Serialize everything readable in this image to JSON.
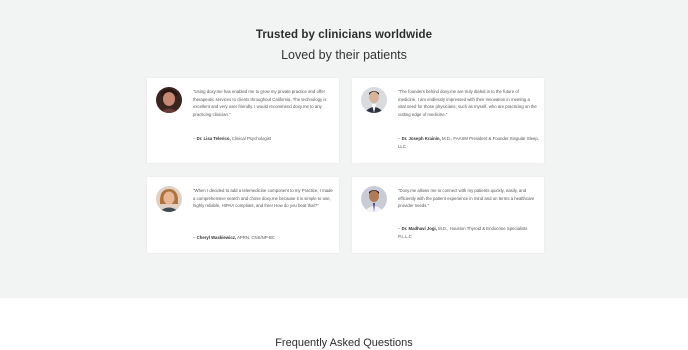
{
  "heading": "Trusted by clinicians worldwide",
  "subheading": "Loved by their patients",
  "testimonials": [
    {
      "quote": "\"Using doxy.me has enabled me to grow my private practice and offer therapeutic services to clients throughout California. The technology is excellent and very user friendly. I would recommend doxy.me to any practicing clinician.\"",
      "name": "Dr. Lisa Telerico,",
      "title": "Clinical Psychologist",
      "avatar_icon": "avatar-woman-dark-hair-icon"
    },
    {
      "quote": "\"The founders behind doxy.me are truly dialed in to the future of medicine. I am endlessly impressed with their innovation in meeting a vital need for those physicians, such as myself, who are practicing on the cutting edge of medicine.\"",
      "name": "Dr. Joseph Krainin,",
      "title": "M.D., FAASM President & Founder Singular Sleep, LLC",
      "avatar_icon": "avatar-man-suit-icon"
    },
    {
      "quote": "\"When I decided to add a telemedicine component to my Practice, I made a comprehensive search and chose doxy.me because it is simple to use, highly reliable, HIPAA compliant, and free! How do you beat that?\"",
      "name": "Cheryl Waskiewicz,",
      "title": "APRN, CNS/NP-BC",
      "avatar_icon": "avatar-woman-light-hair-icon"
    },
    {
      "quote": "\"Doxy.me allows me to connect with my patients quickly, easily, and efficiently with the patient experience in mind and on terms a healthcare provider needs.\"",
      "name": "Dr. Madhavi Jogi,",
      "title": "M.D., Houston Thyroid & Endocrine Specialists P.L.L.C",
      "avatar_icon": "avatar-man-doctor-icon"
    }
  ],
  "faq_heading": "Frequently Asked Questions"
}
